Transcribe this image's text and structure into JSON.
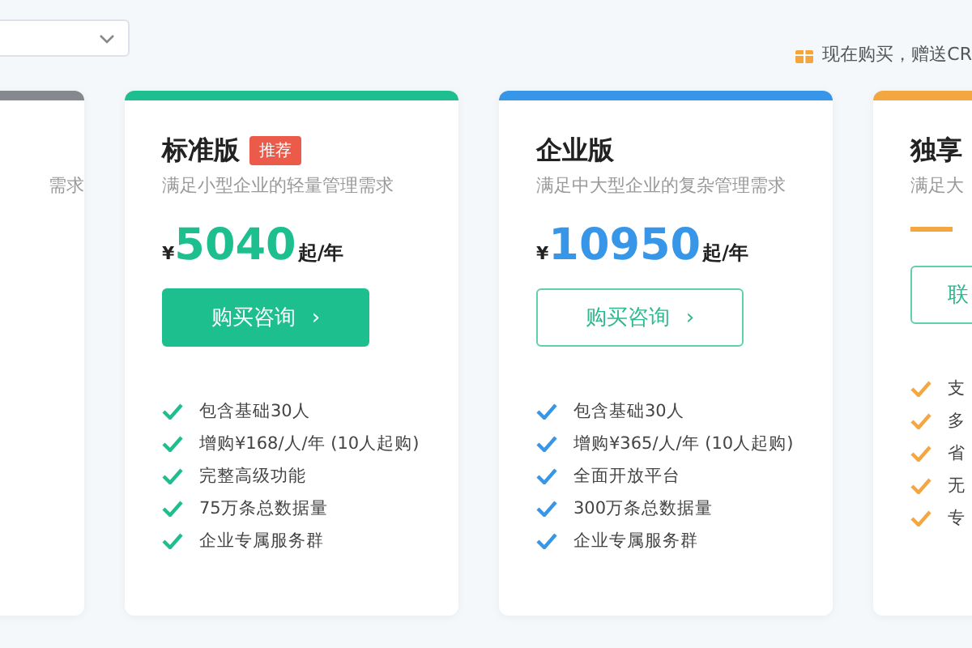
{
  "promo": {
    "text": "现在购买，赠送CR"
  },
  "cards": [
    {
      "color": "#85888d",
      "description": "需求"
    },
    {
      "color": "#1dbf8e",
      "title": "标准版",
      "badge": "推荐",
      "description": "满足小型企业的轻量管理需求",
      "currency": "¥",
      "price": "5040",
      "unit": "起/年",
      "button": {
        "label": "购买咨询",
        "kind": "filled",
        "arrow": "›"
      },
      "features": [
        "包含基础30人",
        "增购¥168/人/年 (10人起购)",
        "完整高级功能",
        "75万条总数据量",
        "企业专属服务群"
      ]
    },
    {
      "color": "#3796e8",
      "title": "企业版",
      "description": "满足中大型企业的复杂管理需求",
      "currency": "¥",
      "price": "10950",
      "unit": "起/年",
      "button": {
        "label": "购买咨询",
        "kind": "outlined",
        "arrow": "›"
      },
      "features": [
        "包含基础30人",
        "增购¥365/人/年 (10人起购)",
        "全面开放平台",
        "300万条总数据量",
        "企业专属服务群"
      ]
    },
    {
      "color": "#f4a641",
      "title": "独享",
      "description": "满足大",
      "dash": true,
      "button": {
        "label": "联",
        "kind": "outlined"
      },
      "features": [
        "支",
        "多",
        "省",
        "无",
        "专"
      ]
    }
  ]
}
